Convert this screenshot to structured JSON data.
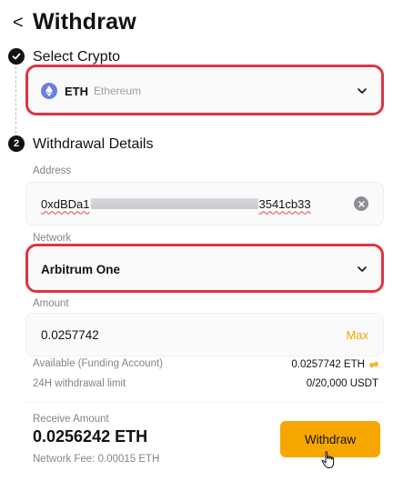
{
  "header": {
    "back_icon": "chevron-left-icon",
    "back_glyph": "<",
    "title": "Withdraw"
  },
  "steps": [
    {
      "title": "Select Crypto",
      "status": "done"
    },
    {
      "number": "2",
      "title": "Withdrawal Details",
      "status": "active"
    }
  ],
  "crypto": {
    "icon": "ethereum-icon",
    "symbol": "ETH",
    "name": "Ethereum"
  },
  "address": {
    "label": "Address",
    "value_start": "0xdBDa1",
    "value_end": "3541cb33",
    "clear_icon": "clear-icon"
  },
  "network": {
    "label": "Network",
    "value": "Arbitrum One"
  },
  "amount": {
    "label": "Amount",
    "value": "0.0257742",
    "max_label": "Max"
  },
  "available": {
    "label": "Available (Funding Account)",
    "value": "0.0257742 ETH",
    "icon": "transfer-icon",
    "icon_glyph": "⇌"
  },
  "limit": {
    "label": "24H withdrawal limit",
    "value": "0/20,000 USDT"
  },
  "receive": {
    "label": "Receive Amount",
    "value": "0.0256242 ETH",
    "fee": "Network Fee: 0.00015 ETH"
  },
  "withdraw_button": "Withdraw",
  "colors": {
    "accent": "#f7a600",
    "highlight_outline": "#e0343f",
    "eth": "#6b7fe3"
  }
}
